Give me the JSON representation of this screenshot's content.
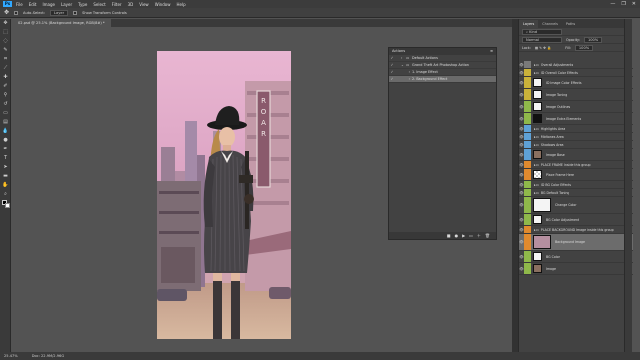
{
  "menubar": {
    "logo": "Ps",
    "items": [
      "File",
      "Edit",
      "Image",
      "Layer",
      "Type",
      "Select",
      "Filter",
      "3D",
      "View",
      "Window",
      "Help"
    ]
  },
  "window_controls": [
    "—",
    "❐",
    "✕"
  ],
  "options": {
    "autoselect": "Auto-Select:",
    "layer": "Layer",
    "transform": "Show Transform Controls"
  },
  "doc_tab": {
    "title": "02.psd @ 25.1% (Background Image, RGB/8#) *"
  },
  "status": {
    "zoom": "25.47%",
    "doc": "Doc: 22.9M/2.96G"
  },
  "actions_panel": {
    "title": "Actions",
    "rows": [
      {
        "label": "Default Actions",
        "level": 0,
        "selected": false
      },
      {
        "label": "Grand Theft Art Photoshop Action",
        "level": 0,
        "selected": false
      },
      {
        "label": "1. Image Effect",
        "level": 1,
        "selected": false
      },
      {
        "label": "2. Background Effect",
        "level": 1,
        "selected": true
      }
    ]
  },
  "layers_panel": {
    "tabs": [
      "Layers",
      "Channels",
      "Paths"
    ],
    "blend_mode": "Normal",
    "opacity_label": "Opacity:",
    "opacity": "100%",
    "lock_label": "Lock:",
    "fill_label": "Fill:",
    "fill": "100%",
    "rows": [
      {
        "name": "Overall Adjustments",
        "color": "#7a7a7a",
        "h": "n",
        "thumb": "none"
      },
      {
        "name": "ID Overall Color Effects",
        "color": "#c9b23a",
        "h": "n",
        "thumb": "none"
      },
      {
        "name": "ID Image Color Effects",
        "color": "#c9b23a",
        "h": "t",
        "thumb": "white"
      },
      {
        "name": "Image Toning",
        "color": "#c9b23a",
        "h": "t",
        "thumb": "white"
      },
      {
        "name": "Image Outlines",
        "color": "#8fb84a",
        "h": "t",
        "thumb": "white"
      },
      {
        "name": "Image Extra Elements",
        "color": "#8fb84a",
        "h": "t",
        "thumb": "black"
      },
      {
        "name": "Highlights Area",
        "color": "#5ea1d6",
        "h": "n",
        "thumb": "none"
      },
      {
        "name": "Midtones Area",
        "color": "#5ea1d6",
        "h": "n",
        "thumb": "none"
      },
      {
        "name": "Shadows Area",
        "color": "#5ea1d6",
        "h": "n",
        "thumb": "none"
      },
      {
        "name": "Image Base",
        "color": "#5ea1d6",
        "h": "t",
        "thumb": "photo"
      },
      {
        "name": "PLACE FRAME Inside this group",
        "color": "#e08a2e",
        "h": "n",
        "thumb": "none"
      },
      {
        "name": "Place Frame Here",
        "color": "#e08a2e",
        "h": "t",
        "thumb": "checker"
      },
      {
        "name": "ID BG Color Effects",
        "color": "#8fb84a",
        "h": "n",
        "thumb": "none"
      },
      {
        "name": "BG Default Toning",
        "color": "#8fb84a",
        "h": "n",
        "thumb": "none"
      },
      {
        "name": "Change Color",
        "color": "#8fb84a",
        "h": "x",
        "thumb": "white"
      },
      {
        "name": "BG Color Adjustment",
        "color": "#8fb84a",
        "h": "t",
        "thumb": "white"
      },
      {
        "name": "PLACE BACKGROUND Image inside this group",
        "color": "#e08a2e",
        "h": "n",
        "thumb": "none"
      },
      {
        "name": "Background Image",
        "color": "#e08a2e",
        "h": "x",
        "thumb": "street",
        "selected": true
      },
      {
        "name": "BG Color",
        "color": "#8fb84a",
        "h": "t",
        "thumb": "white"
      },
      {
        "name": "Image",
        "color": "#8fb84a",
        "h": "t",
        "thumb": "photo"
      }
    ]
  }
}
